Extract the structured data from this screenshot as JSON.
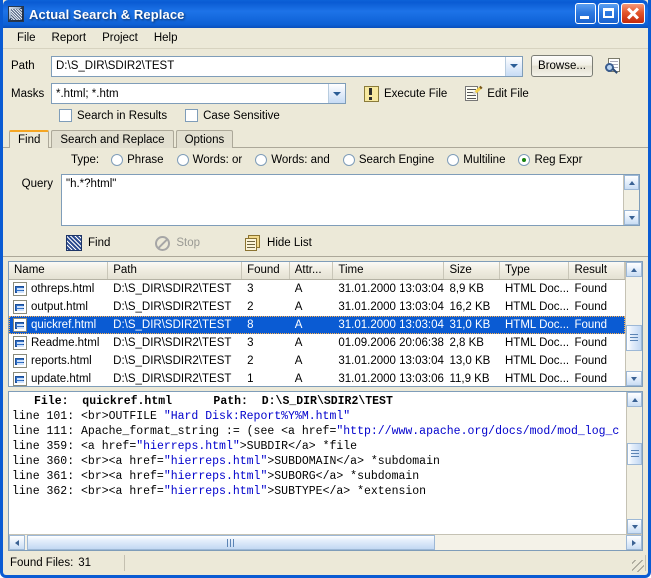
{
  "window": {
    "title": "Actual Search & Replace",
    "icon": "app-icon",
    "buttons": {
      "minimize": "minimize",
      "maximize": "maximize",
      "close": "close"
    }
  },
  "menu": {
    "items": [
      "File",
      "Report",
      "Project",
      "Help"
    ]
  },
  "search": {
    "path_label": "Path",
    "path_value": "D:\\S_DIR\\SDIR2\\TEST",
    "browse_label": "Browse...",
    "preview_icon": "path-preview-icon",
    "masks_label": "Masks",
    "masks_value": "*.html; *.htm",
    "execute_label": "Execute File",
    "edit_label": "Edit File",
    "checkboxes": [
      {
        "label": "Search in Results",
        "checked": false
      },
      {
        "label": "Case Sensitive",
        "checked": false
      }
    ]
  },
  "tabs": [
    {
      "label": "Find",
      "active": true
    },
    {
      "label": "Search and Replace",
      "active": false
    },
    {
      "label": "Options",
      "active": false
    }
  ],
  "find": {
    "type_label": "Type:",
    "types": [
      {
        "label": "Phrase",
        "selected": false
      },
      {
        "label": "Words: or",
        "selected": false
      },
      {
        "label": "Words: and",
        "selected": false
      },
      {
        "label": "Search Engine",
        "selected": false
      },
      {
        "label": "Multiline",
        "selected": false
      },
      {
        "label": "Reg Expr",
        "selected": true
      }
    ],
    "query_label": "Query",
    "query_value": "\"h.*?html\"",
    "actions": [
      {
        "label": "Find",
        "icon": "find-icon",
        "disabled": false
      },
      {
        "label": "Stop",
        "icon": "stop-icon",
        "disabled": true
      },
      {
        "label": "Hide List",
        "icon": "hide-list-icon",
        "disabled": false
      }
    ]
  },
  "results": {
    "columns": [
      "Name",
      "Path",
      "Found",
      "Attr...",
      "Time",
      "Size",
      "Type",
      "Result"
    ],
    "rows": [
      {
        "name": "othreps.html",
        "path": "D:\\S_DIR\\SDIR2\\TEST",
        "found": "3",
        "attr": "A",
        "time": "31.01.2000 13:03:04",
        "size": "8,9 KB",
        "type": "HTML Doc...",
        "result": "Found",
        "selected": false
      },
      {
        "name": "output.html",
        "path": "D:\\S_DIR\\SDIR2\\TEST",
        "found": "2",
        "attr": "A",
        "time": "31.01.2000 13:03:04",
        "size": "16,2 KB",
        "type": "HTML Doc...",
        "result": "Found",
        "selected": false
      },
      {
        "name": "quickref.html",
        "path": "D:\\S_DIR\\SDIR2\\TEST",
        "found": "8",
        "attr": "A",
        "time": "31.01.2000 13:03:04",
        "size": "31,0 KB",
        "type": "HTML Doc...",
        "result": "Found",
        "selected": true
      },
      {
        "name": "Readme.html",
        "path": "D:\\S_DIR\\SDIR2\\TEST",
        "found": "3",
        "attr": "A",
        "time": "01.09.2006 20:06:38",
        "size": "2,8 KB",
        "type": "HTML Doc...",
        "result": "Found",
        "selected": false
      },
      {
        "name": "reports.html",
        "path": "D:\\S_DIR\\SDIR2\\TEST",
        "found": "2",
        "attr": "A",
        "time": "31.01.2000 13:03:04",
        "size": "13,0 KB",
        "type": "HTML Doc...",
        "result": "Found",
        "selected": false
      },
      {
        "name": "update.html",
        "path": "D:\\S_DIR\\SDIR2\\TEST",
        "found": "1",
        "attr": "A",
        "time": "31.01.2000 13:03:06",
        "size": "11,9 KB",
        "type": "HTML Doc...",
        "result": "Found",
        "selected": false
      }
    ]
  },
  "preview": {
    "file_label": "File:",
    "file_value": "quickref.html",
    "path_label": "Path:",
    "path_value": "D:\\S_DIR\\SDIR2\\TEST",
    "lines": [
      {
        "prefix": "line 101: <br>OUTFILE ",
        "match": "\"Hard Disk:Report%Y%M.html\"",
        "suffix": ""
      },
      {
        "prefix": "line 111: Apache_format_string := (see <a href=",
        "match": "\"http://www.apache.org/docs/mod/mod_log_c",
        "suffix": ""
      },
      {
        "prefix": "line 359: <a href=",
        "match": "\"hierreps.html\"",
        "suffix": ">SUBDIR</a> *file"
      },
      {
        "prefix": "line 360: <br><a href=",
        "match": "\"hierreps.html\"",
        "suffix": ">SUBDOMAIN</a> *subdomain"
      },
      {
        "prefix": "line 361: <br><a href=",
        "match": "\"hierreps.html\"",
        "suffix": ">SUBORG</a> *subdomain"
      },
      {
        "prefix": "line 362: <br><a href=",
        "match": "\"hierreps.html\"",
        "suffix": ">SUBTYPE</a> *extension"
      }
    ]
  },
  "status": {
    "found_files_label": "Found Files:",
    "found_files_count": "31"
  },
  "colors": {
    "titlebar_blue": "#0a5bd3",
    "selection_blue": "#0a5bd3",
    "match_highlight": "#0000cc",
    "active_tab_accent": "#f5a623",
    "window_face": "#ece9d8"
  }
}
